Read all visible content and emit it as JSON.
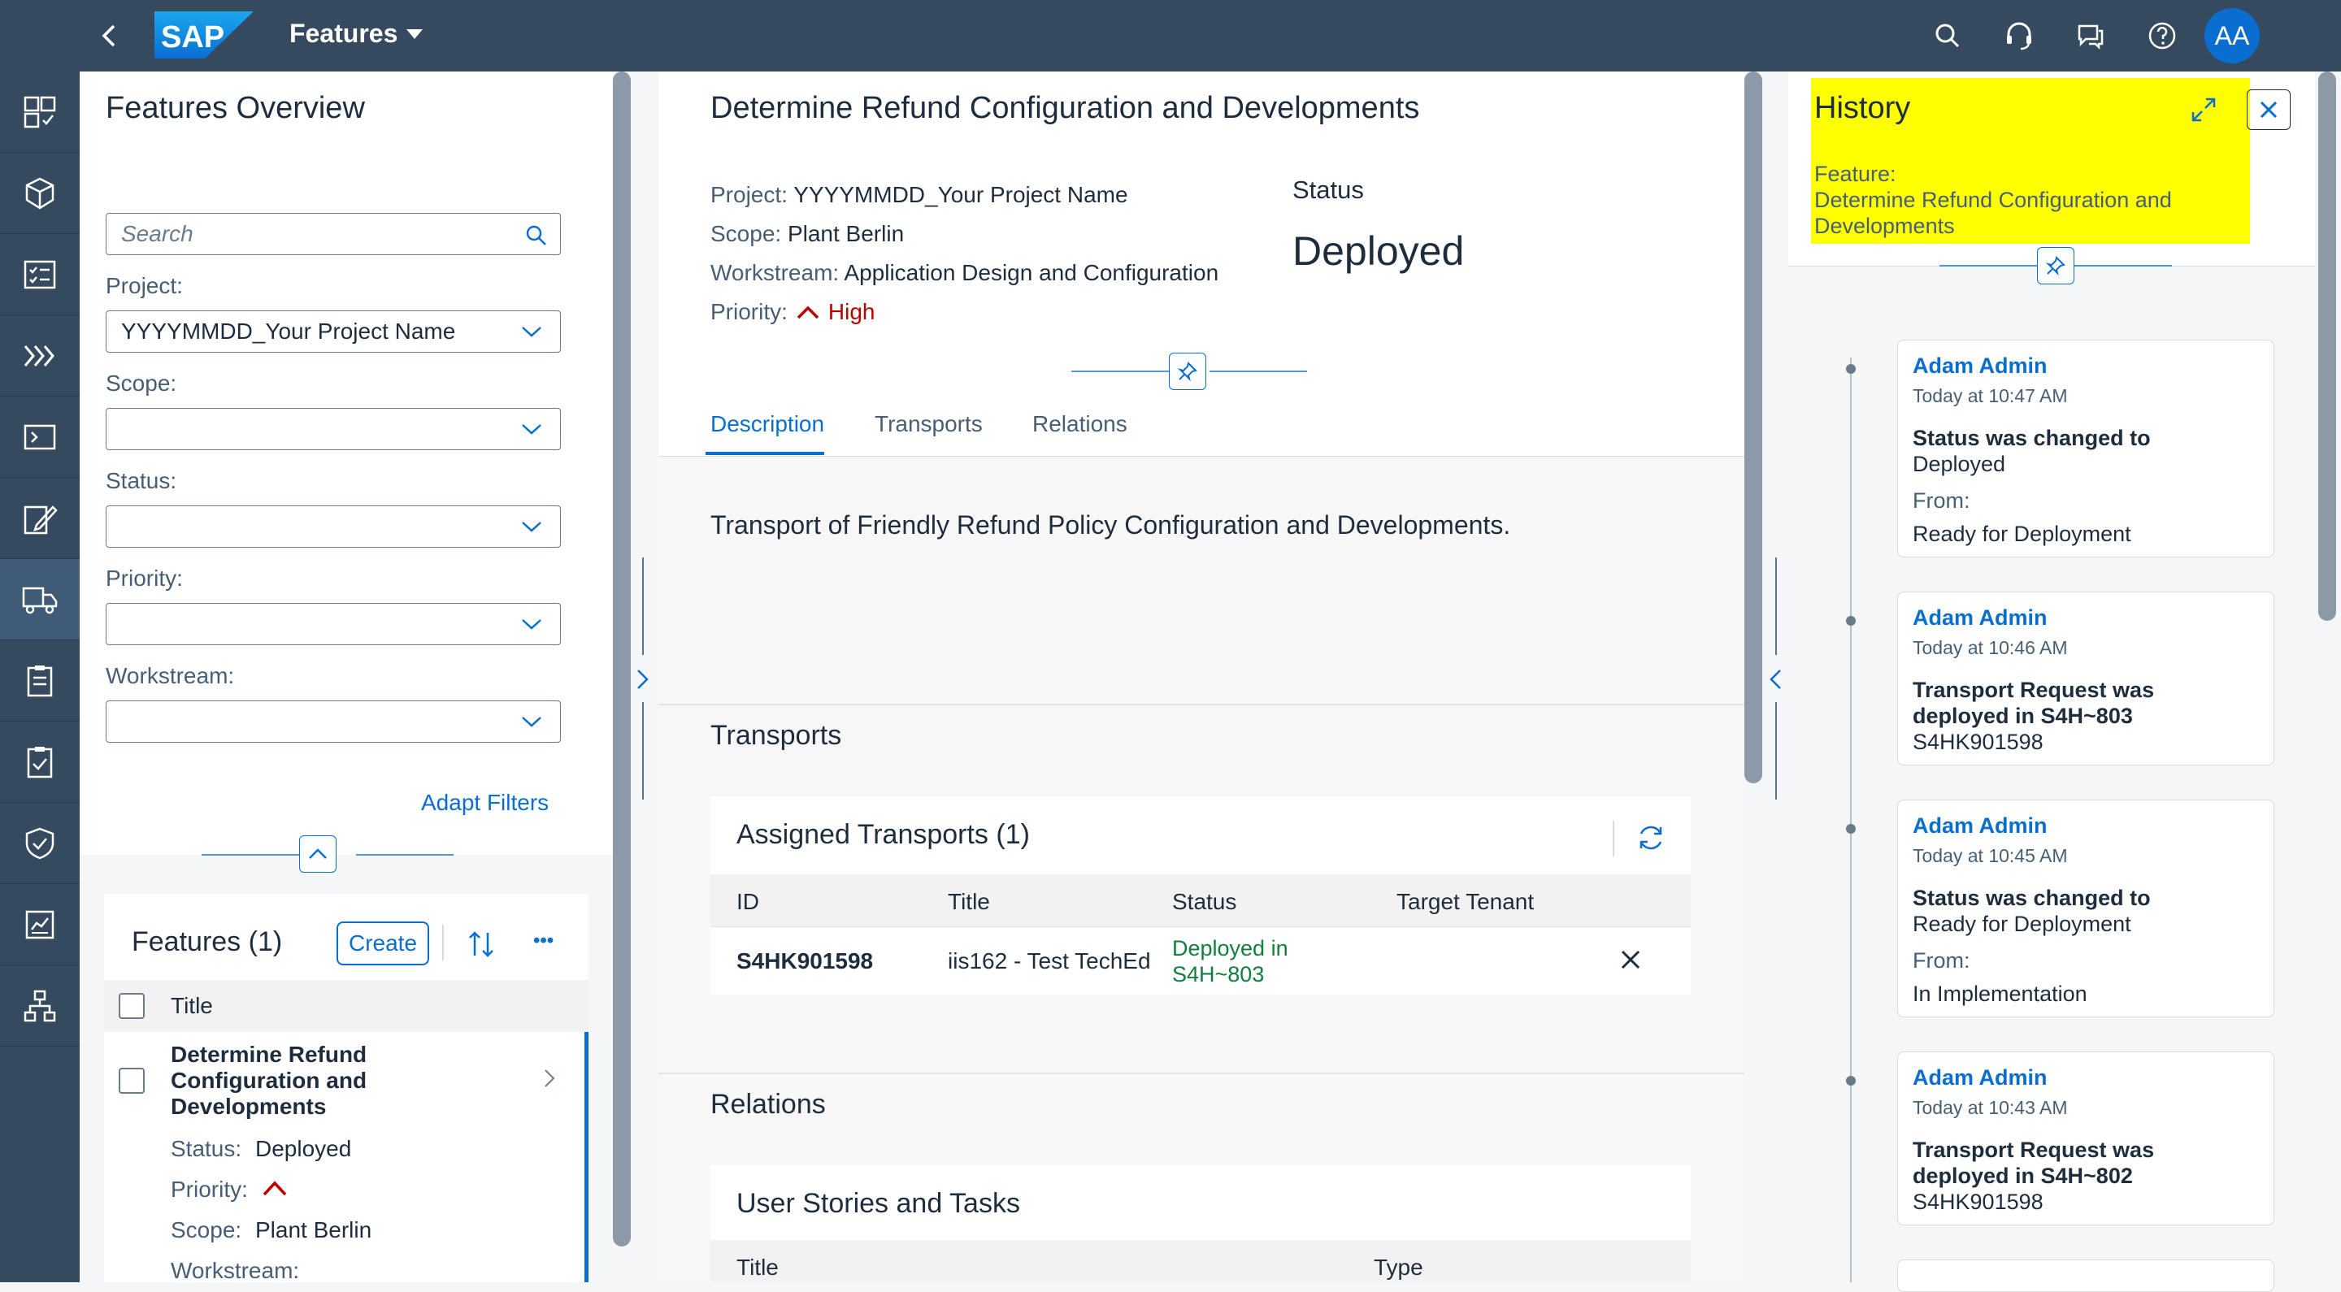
{
  "shell": {
    "app_title": "Features",
    "logo_text": "SAP",
    "avatar_initials": "AA",
    "icons": [
      "search-icon",
      "headset-icon",
      "feedback-icon",
      "help-icon"
    ]
  },
  "sidenav": {
    "items": [
      "overview-icon",
      "package-icon",
      "checklist-icon",
      "chevrons-icon",
      "terminal-icon",
      "edit-icon",
      "truck-icon",
      "clipboard-icon",
      "clipboard-check-icon",
      "shield-icon",
      "report-icon",
      "hierarchy-icon"
    ],
    "active_index": 6
  },
  "left": {
    "title": "Features Overview",
    "search_placeholder": "Search",
    "filters": {
      "project_label": "Project:",
      "project_value": "YYYYMMDD_Your Project Name",
      "scope_label": "Scope:",
      "status_label": "Status:",
      "priority_label": "Priority:",
      "workstream_label": "Workstream:"
    },
    "adapt_filters": "Adapt Filters",
    "list_title": "Features (1)",
    "create_label": "Create",
    "more_label": "•••",
    "col_title": "Title",
    "item": {
      "title_line1": "Determine Refund",
      "title_line2": "Configuration and",
      "title_line3": "Developments",
      "status_label": "Status:",
      "status_value": "Deployed",
      "priority_label": "Priority:",
      "scope_label": "Scope:",
      "scope_value": "Plant Berlin",
      "workstream_label": "Workstream:"
    }
  },
  "detail": {
    "title": "Determine Refund Configuration and Developments",
    "project_label": "Project:",
    "project_value": "YYYYMMDD_Your Project Name",
    "scope_label": "Scope:",
    "scope_value": "Plant Berlin",
    "workstream_label": "Workstream:",
    "workstream_value": "Application Design and Configuration",
    "priority_label": "Priority:",
    "priority_value": "High",
    "status_label": "Status",
    "status_value": "Deployed",
    "tabs": [
      "Description",
      "Transports",
      "Relations"
    ],
    "description": "Transport of Friendly Refund Policy Configuration and Developments.",
    "transports_title": "Transports",
    "assigned_title": "Assigned Transports (1)",
    "columns": [
      "ID",
      "Title",
      "Status",
      "Target Tenant"
    ],
    "rows": [
      {
        "id": "S4HK901598",
        "title": "iis162 - Test TechEd",
        "status_line1": "Deployed in",
        "status_line2": "S4H~803",
        "tenant": ""
      }
    ],
    "relations_title": "Relations",
    "stories_title": "User Stories and Tasks",
    "stories_columns": [
      "Title",
      "Type"
    ]
  },
  "history": {
    "title": "History",
    "feature_label": "Feature:",
    "feature_line1": "Determine Refund Configuration and",
    "feature_line2": "Developments",
    "entries": [
      {
        "who": "Adam Admin",
        "when": "Today at 10:47 AM",
        "act": "Status was changed to",
        "val": "Deployed",
        "from_label": "From:",
        "from": "Ready for Deployment"
      },
      {
        "who": "Adam Admin",
        "when": "Today at 10:46 AM",
        "act1": "Transport Request was",
        "act2": "deployed in S4H~803",
        "val": "S4HK901598"
      },
      {
        "who": "Adam Admin",
        "when": "Today at 10:45 AM",
        "act": "Status was changed to",
        "val": "Ready for Deployment",
        "from_label": "From:",
        "from": "In Implementation"
      },
      {
        "who": "Adam Admin",
        "when": "Today at 10:43 AM",
        "act1": "Transport Request was",
        "act2": "deployed in S4H~802",
        "val": "S4HK901598"
      }
    ],
    "highlight_color": "#ffff00"
  },
  "colors": {
    "shell": "#354a5f",
    "accent": "#0a6ed1",
    "positive": "#107e3e",
    "negative": "#bb0000"
  }
}
